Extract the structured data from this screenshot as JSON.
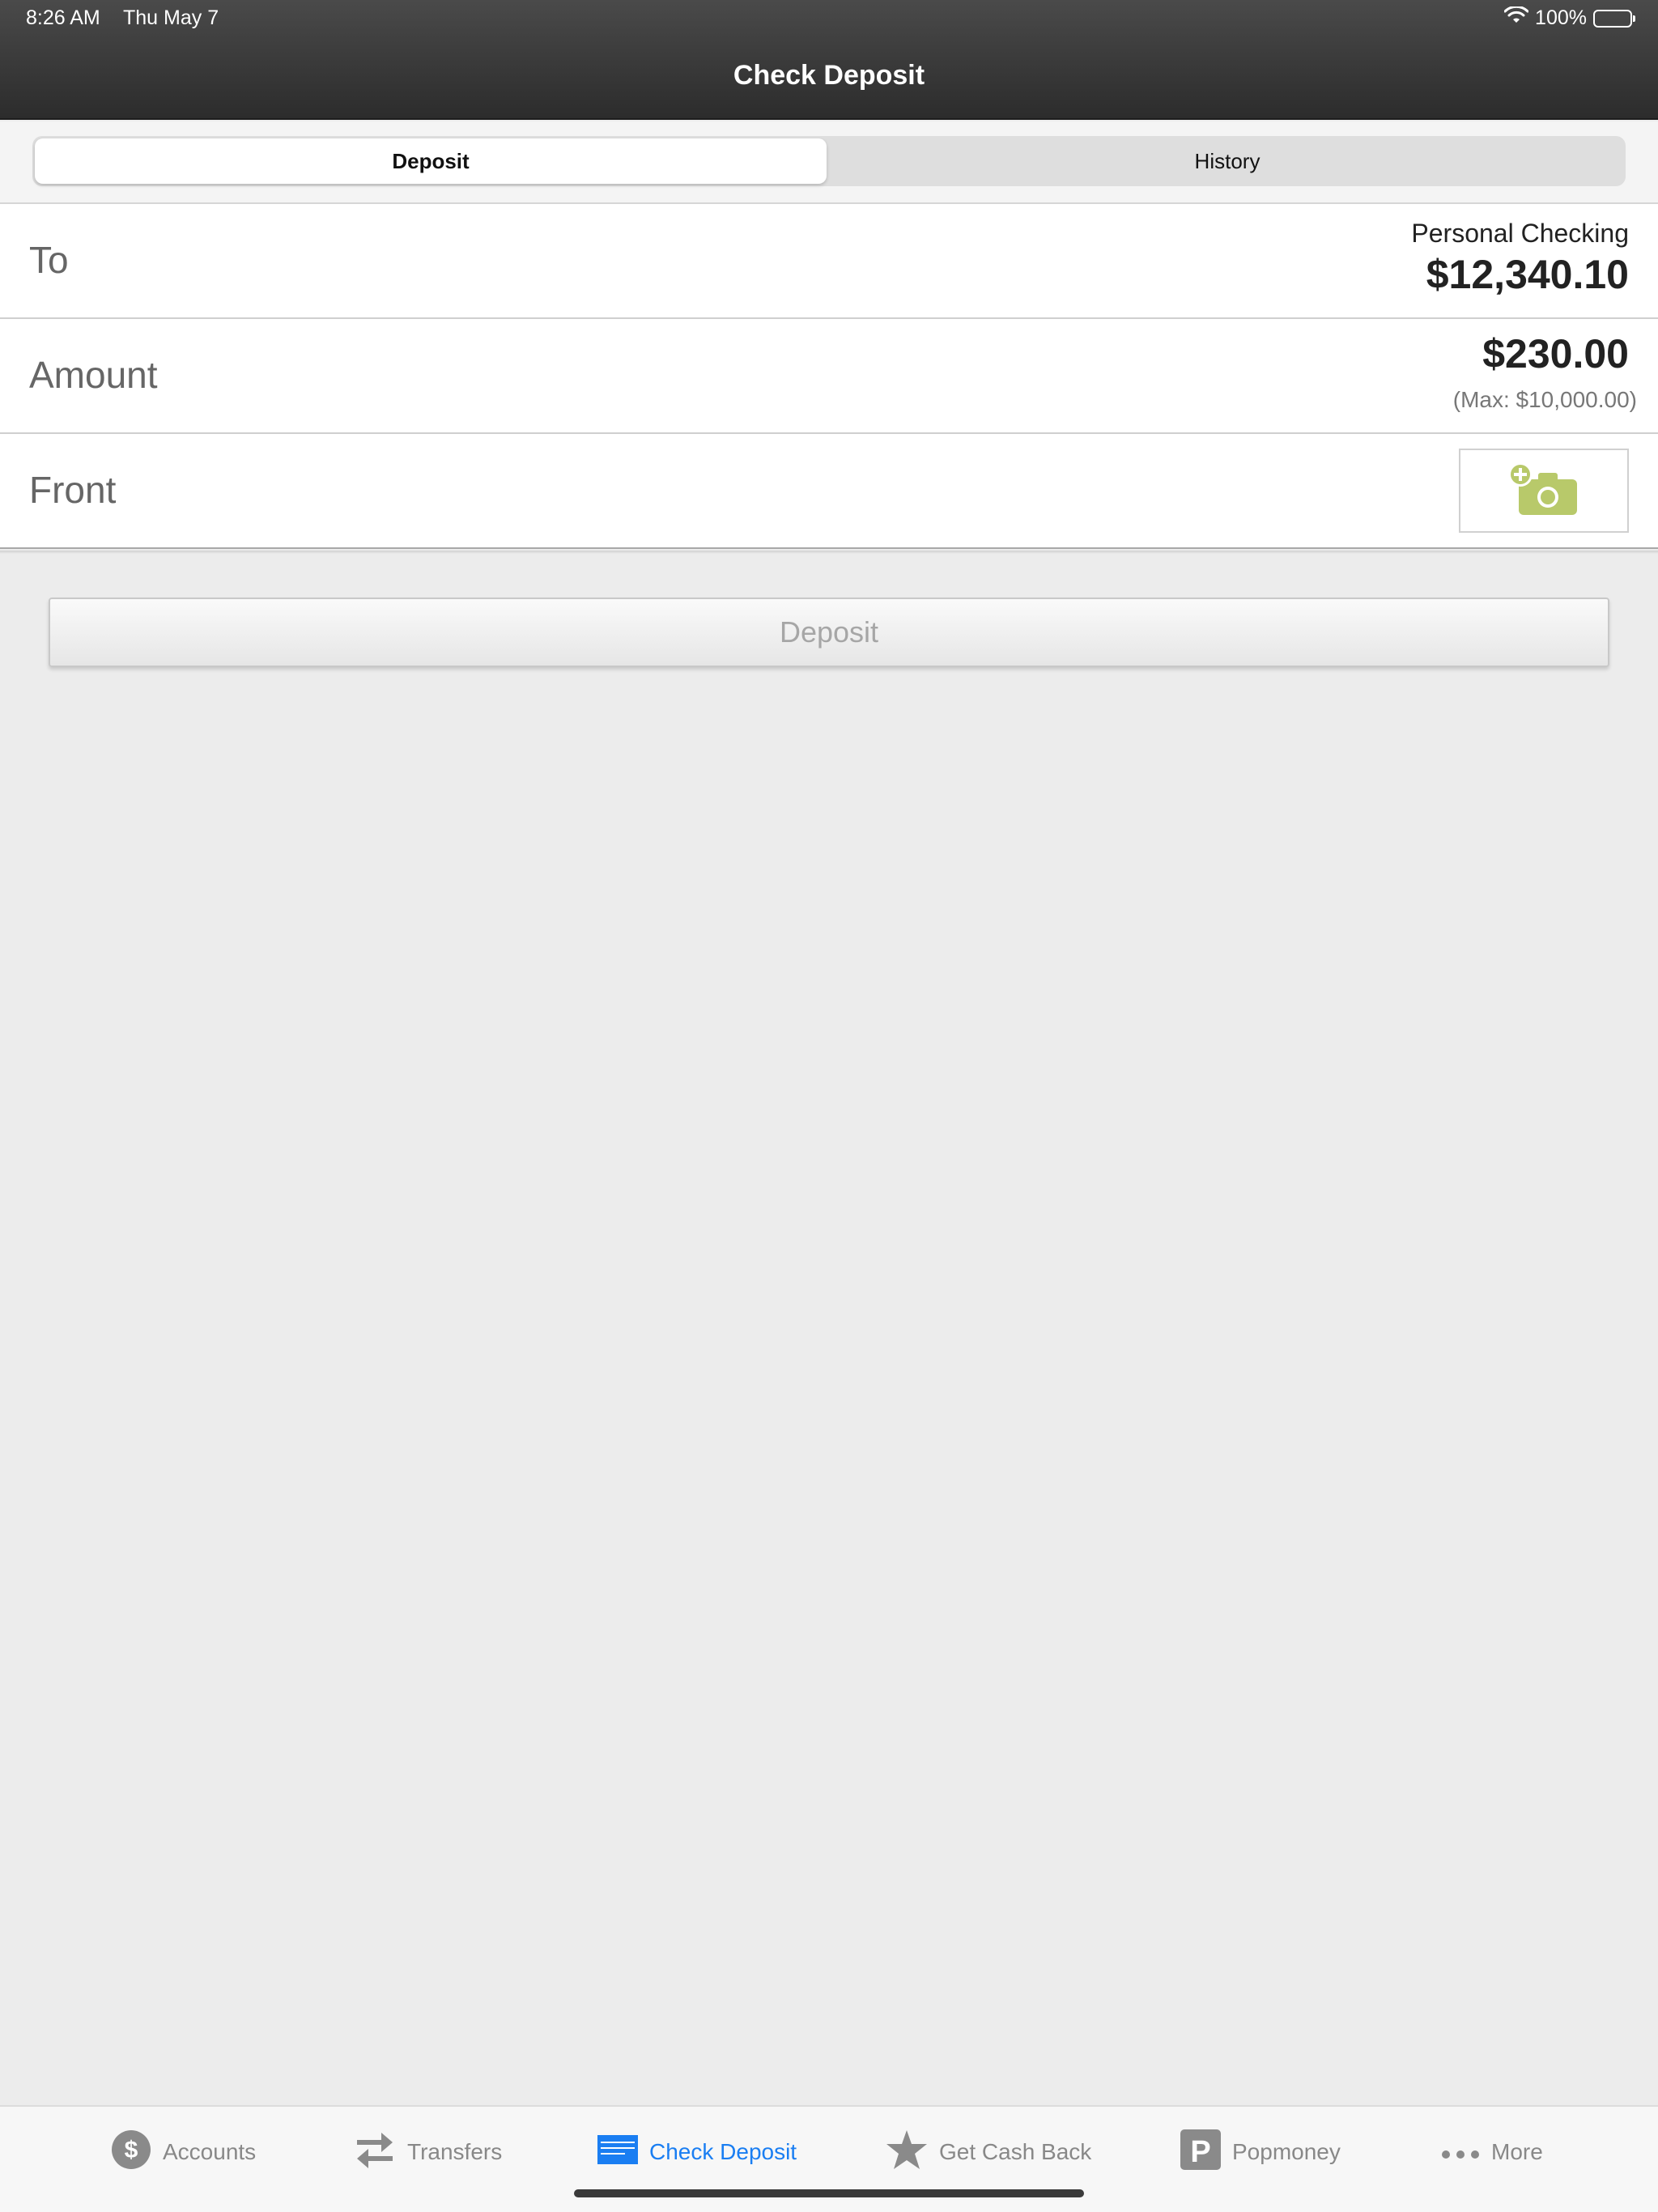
{
  "status": {
    "time": "8:26 AM",
    "date": "Thu May 7",
    "battery": "100%"
  },
  "header": {
    "title": "Check Deposit"
  },
  "segments": {
    "deposit": "Deposit",
    "history": "History"
  },
  "form": {
    "to_label": "To",
    "to_account": "Personal Checking",
    "to_balance": "$12,340.10",
    "amount_label": "Amount",
    "amount_value": "$230.00",
    "amount_max": "(Max: $10,000.00)",
    "front_label": "Front"
  },
  "deposit_button": "Deposit",
  "tabs": {
    "accounts": "Accounts",
    "transfers": "Transfers",
    "check_deposit": "Check Deposit",
    "get_cash_back": "Get Cash Back",
    "popmoney": "Popmoney",
    "more": "More"
  },
  "colors": {
    "accent": "#1a7ef2",
    "camera_icon": "#b8c96a",
    "header_bg": "#3a3a3a"
  }
}
